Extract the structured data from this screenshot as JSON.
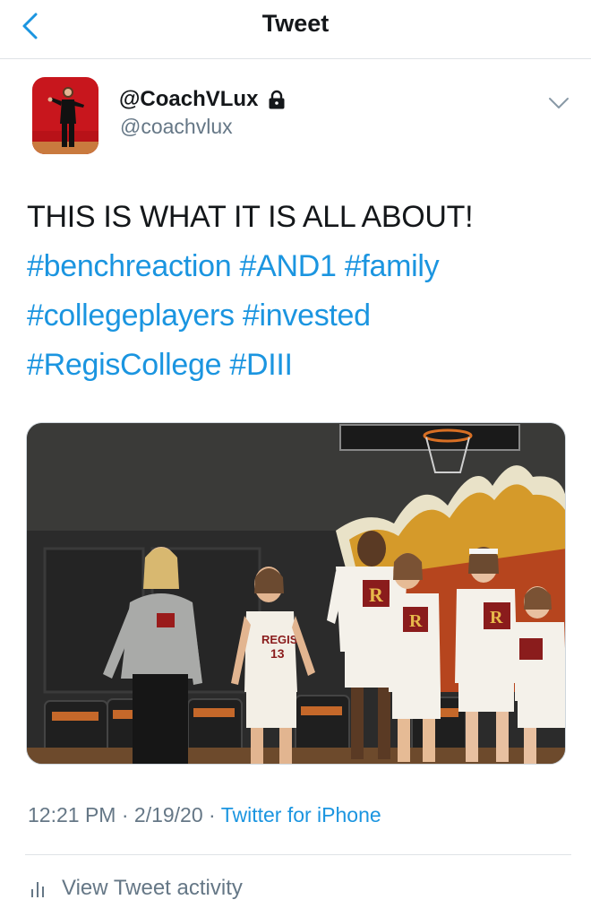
{
  "header": {
    "title": "Tweet",
    "back_icon": "chevron-left-icon",
    "accent_color": "#1b95e0"
  },
  "author": {
    "display_name": "@CoachVLux",
    "handle": "@coachvlux",
    "protected_icon": "lock-icon",
    "menu_icon": "chevron-down-icon"
  },
  "tweet": {
    "text_plain": "THIS IS WHAT IT IS ALL ABOUT!",
    "hashtags": [
      "#benchreaction",
      "#AND1",
      "#family",
      "#collegeplayers",
      "#invested",
      "#RegisCollege",
      "#DIII"
    ],
    "hashtag_color": "#1b95e0"
  },
  "photo": {
    "jersey_text": "REGIS",
    "jersey_number": "13",
    "team_letter": "R"
  },
  "meta": {
    "time": "12:21 PM",
    "separator": "·",
    "date": "2/19/20",
    "source": "Twitter for iPhone"
  },
  "activity": {
    "label": "View Tweet activity",
    "icon": "bar-chart-icon"
  }
}
